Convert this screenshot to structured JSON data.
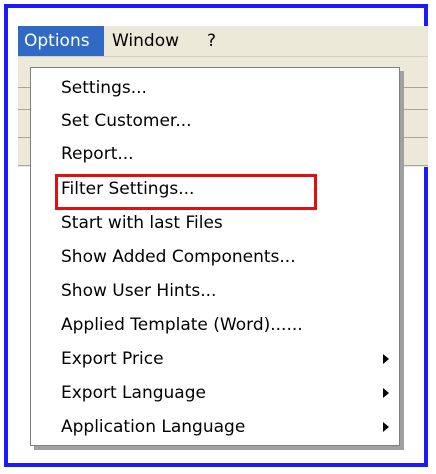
{
  "menubar": {
    "items": [
      {
        "label": "Options",
        "active": true
      },
      {
        "label": "Window",
        "active": false
      },
      {
        "label": "?",
        "active": false
      }
    ]
  },
  "dropdown": {
    "items": [
      {
        "label": "Settings...",
        "submenu": false
      },
      {
        "label": "Set Customer...",
        "submenu": false
      },
      {
        "label": "Report...",
        "submenu": false
      },
      {
        "label": "Filter Settings...",
        "submenu": false,
        "highlighted": true
      },
      {
        "label": "Start with last Files",
        "submenu": false
      },
      {
        "label": "Show Added Components...",
        "submenu": false
      },
      {
        "label": "Show User Hints...",
        "submenu": false
      },
      {
        "label": "Applied Template (Word)......",
        "submenu": false
      },
      {
        "label": "Export Price",
        "submenu": true
      },
      {
        "label": "Export Language",
        "submenu": true
      },
      {
        "label": "Application Language",
        "submenu": true
      }
    ]
  },
  "colors": {
    "frame_border": "#1a1aff",
    "menubar_active": "#316ac5",
    "highlight_box": "#e01010",
    "menubar_bg": "#ece9d8"
  }
}
